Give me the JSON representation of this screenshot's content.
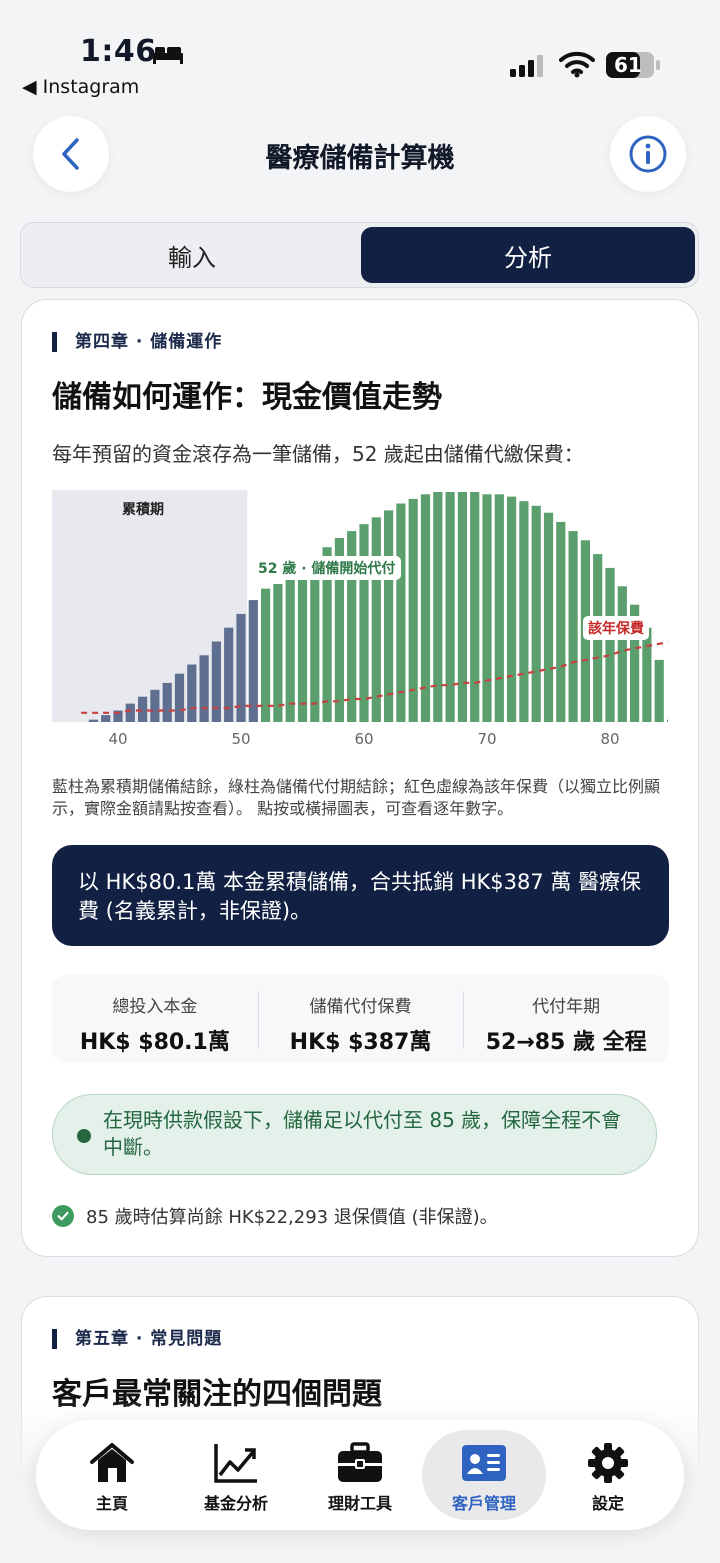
{
  "status_bar": {
    "time": "1:46",
    "back_app": "◀ Instagram",
    "battery": "61"
  },
  "header": {
    "title": "醫療儲備計算機"
  },
  "tabs": [
    {
      "label": "輸入"
    },
    {
      "label": "分析"
    }
  ],
  "section4": {
    "chapter": "第四章 · 儲備運作",
    "title": "儲備如何運作：現金價值走勢",
    "intro": "每年預留的資金滾存為一筆儲備，52 歲起由儲備代繳保費：",
    "note": "藍柱為累積期儲備結餘，綠柱為儲備代付期結餘；紅色虛線為該年保費（以獨立比例顯示，實際金額請點按查看）。 點按或橫掃圖表，可查看逐年數字。",
    "summary": "以 HK$80.1萬 本金累積儲備，合共抵銷 HK$387 萬 醫療保費 (名義累計，非保證)。",
    "stats": [
      {
        "label": "總投入本金",
        "value": "HK$ $80.1萬"
      },
      {
        "label": "儲備代付保費",
        "value": "HK$ $387萬"
      },
      {
        "label": "代付年期",
        "value": "52→85 歲 全程"
      }
    ],
    "status_pill": "在現時供款假設下，儲備足以代付至 85 歲，保障全程不會中斷。",
    "check_note": "85 歲時估算尚餘 HK$22,293 退保價值 (非保證)。"
  },
  "section5": {
    "chapter": "第五章 · 常見問題",
    "title": "客戶最常關注的四個問題"
  },
  "chart_data": {
    "type": "bar",
    "phase_label": "累積期",
    "start_annotation": "52 歲 · 儲備開始代付",
    "premium_annotation": "該年保費",
    "x_ticks": [
      "40",
      "50",
      "60",
      "70",
      "80"
    ],
    "ages": [
      37,
      38,
      39,
      40,
      41,
      42,
      43,
      44,
      45,
      46,
      47,
      48,
      49,
      50,
      51,
      52,
      53,
      54,
      55,
      56,
      57,
      58,
      59,
      60,
      61,
      62,
      63,
      64,
      65,
      66,
      67,
      68,
      69,
      70,
      71,
      72,
      73,
      74,
      75,
      76,
      77,
      78,
      79,
      80,
      81,
      82,
      83,
      84,
      85
    ],
    "series": [
      {
        "values": [
          0,
          0.01,
          0.03,
          0.05,
          0.08,
          0.11,
          0.14,
          0.17,
          0.21,
          0.25,
          0.29,
          0.35,
          0.41,
          0.47,
          0.53,
          0.58,
          0.6,
          0.65,
          0.68,
          0.72,
          0.76,
          0.8,
          0.83,
          0.86,
          0.89,
          0.92,
          0.95,
          0.97,
          0.99,
          1.0,
          1.0,
          1.0,
          1.0,
          0.99,
          0.99,
          0.98,
          0.96,
          0.94,
          0.91,
          0.87,
          0.83,
          0.79,
          0.73,
          0.67,
          0.59,
          0.51,
          0.41,
          0.27,
          0.01
        ]
      },
      {
        "values": [
          0.04,
          0.04,
          0.04,
          0.04,
          0.05,
          0.05,
          0.05,
          0.05,
          0.05,
          0.06,
          0.06,
          0.06,
          0.06,
          0.07,
          0.07,
          0.07,
          0.07,
          0.08,
          0.08,
          0.08,
          0.09,
          0.09,
          0.1,
          0.1,
          0.11,
          0.12,
          0.13,
          0.14,
          0.15,
          0.16,
          0.16,
          0.17,
          0.17,
          0.18,
          0.19,
          0.2,
          0.21,
          0.22,
          0.23,
          0.24,
          0.26,
          0.27,
          0.28,
          0.29,
          0.31,
          0.32,
          0.33,
          0.34,
          0.35
        ]
      }
    ],
    "accumulation_end_age": 51,
    "colors": {
      "accumulation": "#5f6f90",
      "payout": "#5b9f6e",
      "premium": "#c84040",
      "phase_bg": "#e8e9ee"
    },
    "ylim": [
      0,
      1
    ]
  },
  "nav": {
    "items": [
      {
        "label": "主頁",
        "icon": "home-icon"
      },
      {
        "label": "基金分析",
        "icon": "chart-icon"
      },
      {
        "label": "理財工具",
        "icon": "briefcase-icon"
      },
      {
        "label": "客戶管理",
        "icon": "contact-card-icon"
      },
      {
        "label": "設定",
        "icon": "gear-icon"
      }
    ],
    "active": 3
  }
}
